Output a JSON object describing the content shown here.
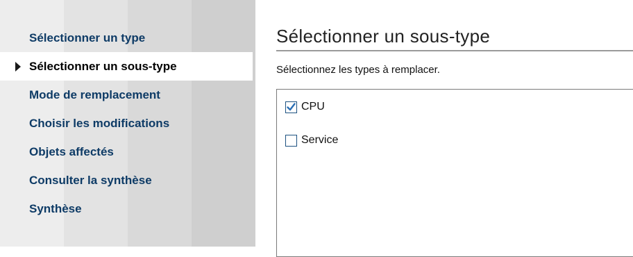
{
  "sidebar": {
    "steps": [
      {
        "label": "Sélectionner un type",
        "current": false
      },
      {
        "label": "Sélectionner un sous-type",
        "current": true
      },
      {
        "label": "Mode de remplacement",
        "current": false
      },
      {
        "label": "Choisir les modifications",
        "current": false
      },
      {
        "label": "Objets affectés",
        "current": false
      },
      {
        "label": "Consulter la synthèse",
        "current": false
      },
      {
        "label": "Synthèse",
        "current": false
      }
    ]
  },
  "main": {
    "title": "Sélectionner un sous-type",
    "instruction": "Sélectionnez les types à remplacer.",
    "options": [
      {
        "label": "CPU",
        "checked": true
      },
      {
        "label": "Service",
        "checked": false
      }
    ]
  },
  "colors": {
    "link": "#0e3b66",
    "checkmark": "#2a6fb5"
  },
  "icons": {
    "current_step": "triangle-right-icon",
    "checked": "checkmark-icon"
  }
}
